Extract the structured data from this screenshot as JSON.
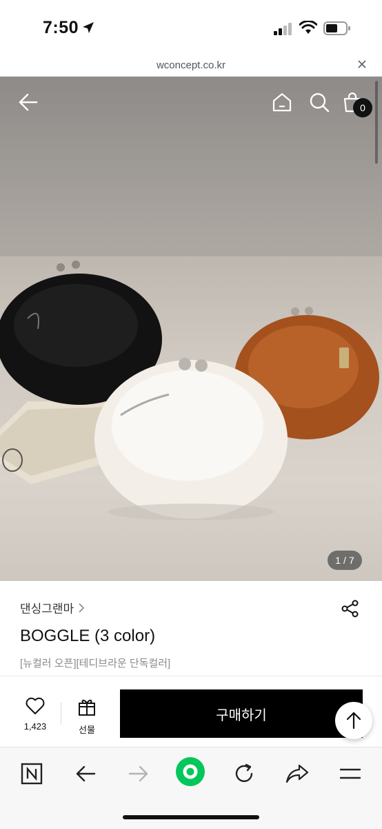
{
  "status_bar": {
    "time": "7:50"
  },
  "url_bar": {
    "url": "wconcept.co.kr"
  },
  "hero": {
    "cart_count": "0",
    "image_index": "1",
    "image_separator": "/",
    "image_total": "7"
  },
  "product": {
    "brand": "댄싱그랜마",
    "title": "BOGGLE (3 color)",
    "subtitle": "[뉴컬러 오픈][테디브라운 단독컬러]"
  },
  "actions": {
    "like_count": "1,423",
    "gift_label": "선물",
    "buy_label": "구매하기"
  },
  "colors": {
    "accent": "#000000",
    "naver_green": "#03c75a"
  }
}
